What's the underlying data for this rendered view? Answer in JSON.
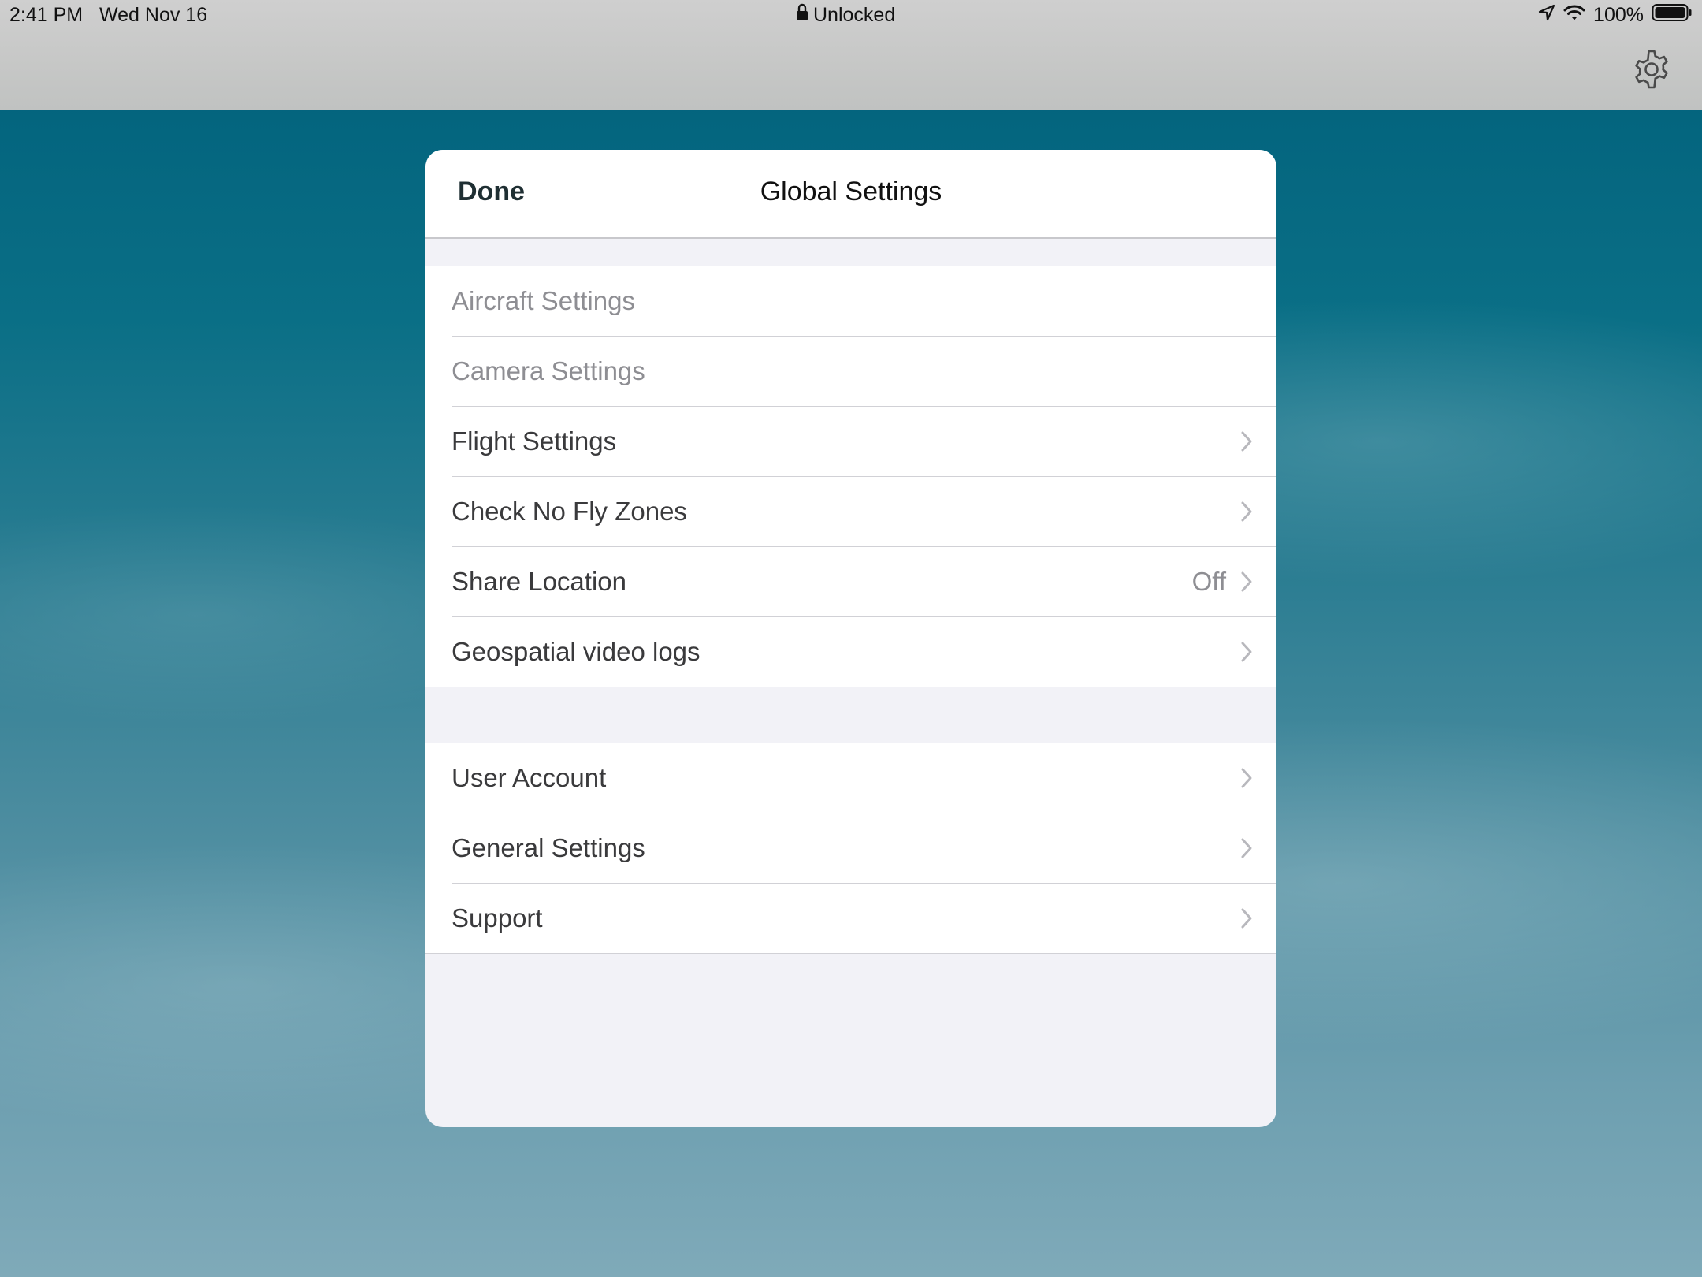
{
  "status_bar": {
    "time": "2:41 PM",
    "date": "Wed Nov 16",
    "lock_status": "Unlocked",
    "battery": "100%",
    "icons": [
      "lock-icon",
      "location-arrow-icon",
      "wifi-icon",
      "battery-icon"
    ]
  },
  "toolbar": {
    "settings_icon": "gear-icon"
  },
  "modal": {
    "done_label": "Done",
    "title": "Global Settings",
    "group1": [
      {
        "label": "Aircraft Settings",
        "enabled": false
      },
      {
        "label": "Camera Settings",
        "enabled": false
      },
      {
        "label": "Flight Settings",
        "enabled": true
      },
      {
        "label": "Check No Fly Zones",
        "enabled": true
      },
      {
        "label": "Share Location",
        "value": "Off",
        "enabled": true
      },
      {
        "label": "Geospatial video logs",
        "enabled": true
      }
    ],
    "group2": [
      {
        "label": "User Account",
        "enabled": true
      },
      {
        "label": "General Settings",
        "enabled": true
      },
      {
        "label": "Support",
        "enabled": true
      }
    ]
  },
  "colors": {
    "disabled_text": "#8e8e93",
    "row_text": "#3a3a3c",
    "chevron": "#b8b8bd",
    "sheet_background": "#f2f2f7"
  }
}
